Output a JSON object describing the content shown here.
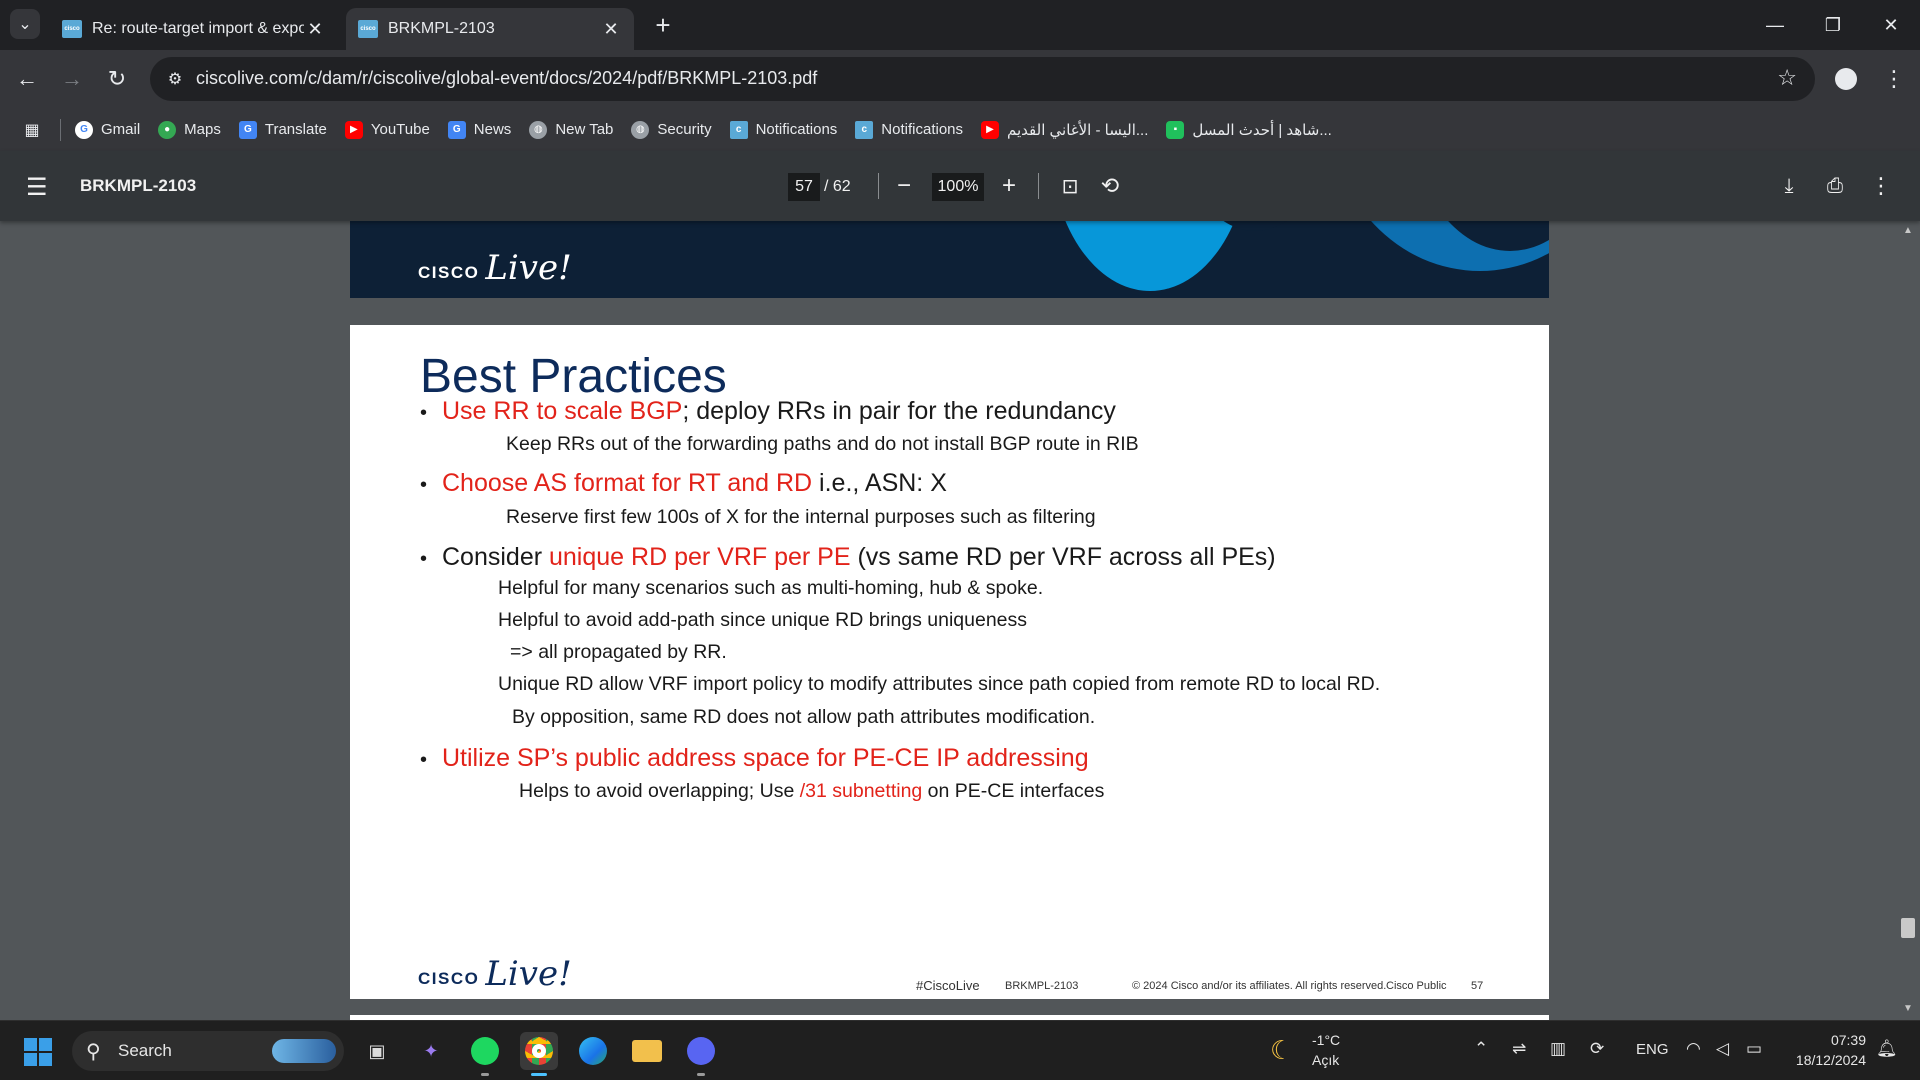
{
  "browser": {
    "tabs": [
      {
        "title": "Re: route-target import & export",
        "active": false
      },
      {
        "title": "BRKMPL-2103",
        "active": true
      }
    ],
    "url": "ciscolive.com/c/dam/r/ciscolive/global-event/docs/2024/pdf/BRKMPL-2103.pdf",
    "bookmarks": [
      {
        "label": "Gmail",
        "icon": "google-icon"
      },
      {
        "label": "Maps",
        "icon": "maps-icon"
      },
      {
        "label": "Translate",
        "icon": "translate-icon"
      },
      {
        "label": "YouTube",
        "icon": "youtube-icon"
      },
      {
        "label": "News",
        "icon": "news-icon"
      },
      {
        "label": "New Tab",
        "icon": "globe-icon"
      },
      {
        "label": "Security",
        "icon": "globe-icon"
      },
      {
        "label": "Notifications",
        "icon": "cisco-icon"
      },
      {
        "label": "Notifications",
        "icon": "cisco-icon"
      },
      {
        "label": "اليسا - الأغاني القديم...",
        "icon": "youtube-icon"
      },
      {
        "label": "شاهد | أحدث المسل...",
        "icon": "shahid-icon"
      }
    ]
  },
  "pdf_viewer": {
    "doc_title": "BRKMPL-2103",
    "current_page": "57",
    "total_pages": "/ 62",
    "zoom": "100%"
  },
  "slide": {
    "logo_cisco": "CISCO",
    "logo_live": "Live!",
    "title": "Best Practices",
    "b1_red": "Use RR to scale BGP",
    "b1_rest": "; deploy RRs in pair for the redundancy",
    "b1_sub": "Keep RRs out of the forwarding paths and do not install BGP route in RIB",
    "b2_red": "Choose AS format for RT and RD",
    "b2_rest": " i.e., ASN: X",
    "b2_sub": "Reserve first few 100s of X for the internal purposes such as filtering",
    "b3_pre": "Consider ",
    "b3_red": "unique RD per VRF per PE",
    "b3_rest": " (vs same RD per VRF across all PEs)",
    "b3_sub1": "Helpful for many scenarios such as multi-homing, hub & spoke.",
    "b3_sub2": "Helpful to avoid add-path since unique RD brings uniqueness",
    "b3_sub3": "=> all propagated by RR.",
    "b3_sub4": "Unique RD allow VRF import policy to modify attributes since path copied from remote RD to  local RD.",
    "b3_sub5": "By opposition, same RD does not allow path attributes modification.",
    "b4_red": "Utilize SP’s public address space for PE-CE IP addressing",
    "b4_sub_pre": "Helps to avoid overlapping; Use ",
    "b4_sub_red": "/31 subnetting",
    "b4_sub_post": " on PE-CE interfaces",
    "footer_tag": "#CiscoLive",
    "footer_code": "BRKMPL-2103",
    "footer_copy": "© 2024  Cisco and/or its affiliates. All rights reserved.",
    "footer_public": "Cisco Public",
    "footer_page": "57"
  },
  "taskbar": {
    "search_label": "Search",
    "weather_temp": "-1°C",
    "weather_desc": "Açık",
    "lang": "ENG",
    "time": "07:39",
    "date": "18/12/2024"
  },
  "colors": {
    "accent_red": "#e2231a",
    "title_navy": "#0d2b5b",
    "chrome_dark": "#202124"
  }
}
